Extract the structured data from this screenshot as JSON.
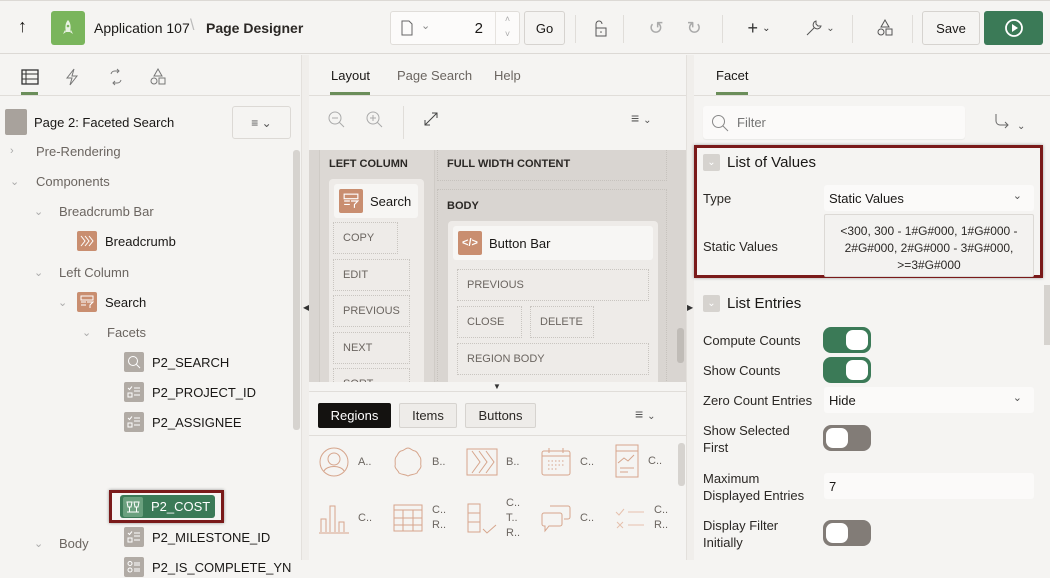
{
  "header": {
    "app_name": "Application 107",
    "separator": "\\",
    "page_title": "Page Designer",
    "page_number": "2",
    "go_label": "Go",
    "save_label": "Save",
    "colors": {
      "app_logo": "#7ab55c",
      "run": "#3b7a57",
      "accent": "#6b8e5a"
    }
  },
  "left_panel": {
    "tabs": [
      "rendering-tab",
      "dynamic-actions-tab",
      "processing-tab",
      "shared-components-tab"
    ],
    "page_node": "Page 2: Faceted Search",
    "tree": [
      {
        "label": "Pre-Rendering",
        "expanded": false
      },
      {
        "label": "Components",
        "expanded": true
      },
      {
        "label": "Breadcrumb Bar",
        "expanded": true
      },
      {
        "label": "Breadcrumb"
      },
      {
        "label": "Left Column",
        "expanded": true
      },
      {
        "label": "Search",
        "expanded": true
      },
      {
        "label": "Facets",
        "expanded": true
      },
      {
        "label": "P2_SEARCH"
      },
      {
        "label": "P2_PROJECT_ID"
      },
      {
        "label": "P2_ASSIGNEE"
      },
      {
        "label": "P2_COST",
        "selected": true
      },
      {
        "label": "P2_MILESTONE_ID"
      },
      {
        "label": "P2_IS_COMPLETE_YN"
      },
      {
        "label": "Body",
        "expanded": true
      }
    ]
  },
  "center_panel": {
    "tabs": [
      {
        "label": "Layout",
        "active": true
      },
      {
        "label": "Page Search"
      },
      {
        "label": "Help"
      }
    ],
    "canvas": {
      "left_column_title": "LEFT COLUMN",
      "full_width_title": "FULL WIDTH CONTENT",
      "body_title": "BODY",
      "search_region": "Search",
      "search_slots": [
        "COPY",
        "EDIT",
        "PREVIOUS",
        "NEXT",
        "SORT"
      ],
      "button_bar_region": "Button Bar",
      "button_bar_slots": [
        "PREVIOUS",
        "CLOSE",
        "DELETE",
        "REGION BODY"
      ]
    },
    "gallery_tabs": [
      {
        "label": "Regions",
        "active": true
      },
      {
        "label": "Items"
      },
      {
        "label": "Buttons"
      }
    ],
    "gallery_items": [
      {
        "icon": "avatar-icon",
        "label": "A.."
      },
      {
        "icon": "badge-icon",
        "label": "B.."
      },
      {
        "icon": "breadcrumb-icon",
        "label": "B.."
      },
      {
        "icon": "calendar-icon",
        "label": "C.."
      },
      {
        "icon": "card-icon",
        "label": "C.."
      },
      {
        "icon": "chart-icon",
        "label": "C.."
      },
      {
        "icon": "classic-report-icon",
        "label": "C.. R.."
      },
      {
        "icon": "column-toggle-report-icon",
        "label": "C.. T.. R.."
      },
      {
        "icon": "comments-icon",
        "label": "C.."
      },
      {
        "icon": "content-row-icon",
        "label": "C.. R.."
      }
    ]
  },
  "right_panel": {
    "tab": "Facet",
    "filter_placeholder": "Filter",
    "sections": {
      "lov": {
        "title": "List of Values",
        "type_label": "Type",
        "type_value": "Static Values",
        "static_label": "Static Values",
        "static_value": "<300, 300 - 1#G#000, 1#G#000 - 2#G#000, 2#G#000 - 3#G#000, >=3#G#000"
      },
      "entries": {
        "title": "List Entries",
        "compute_counts_label": "Compute Counts",
        "compute_counts": true,
        "show_counts_label": "Show Counts",
        "show_counts": true,
        "zero_count_label": "Zero Count Entries",
        "zero_count_value": "Hide",
        "show_selected_label": "Show Selected First",
        "show_selected": false,
        "max_entries_label": "Maximum Displayed Entries",
        "max_entries_value": "7",
        "display_filter_label": "Display Filter Initially",
        "display_filter": false
      }
    }
  }
}
